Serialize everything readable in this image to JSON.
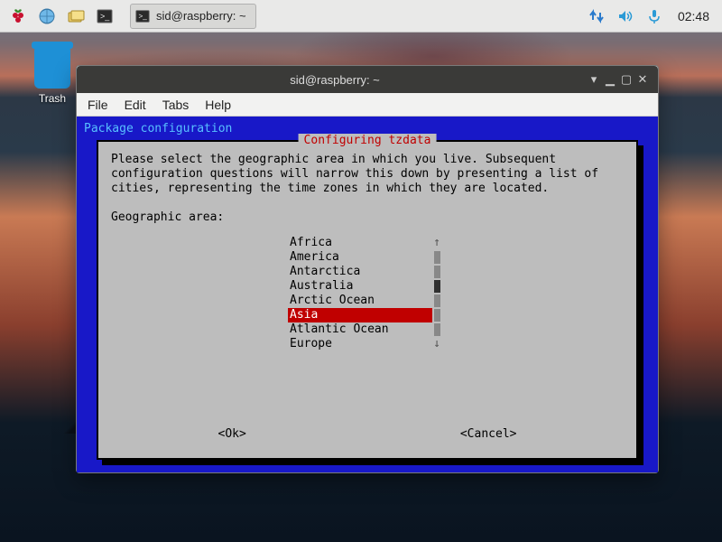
{
  "taskbar": {
    "task_label": "sid@raspberry: ~",
    "clock": "02:48"
  },
  "desktop": {
    "trash_label": "Trash"
  },
  "window": {
    "title": "sid@raspberry: ~",
    "menu": {
      "file": "File",
      "edit": "Edit",
      "tabs": "Tabs",
      "help": "Help"
    }
  },
  "tui": {
    "pkg_line": "Package configuration",
    "box_title": " Configuring tzdata ",
    "body": "Please select the geographic area in which you live. Subsequent\nconfiguration questions will narrow this down by presenting a list of\ncities, representing the time zones in which they are located.\n\nGeographic area:",
    "items": [
      {
        "label": "Africa",
        "selected": false
      },
      {
        "label": "America",
        "selected": false
      },
      {
        "label": "Antarctica",
        "selected": false
      },
      {
        "label": "Australia",
        "selected": false
      },
      {
        "label": "Arctic Ocean",
        "selected": false
      },
      {
        "label": "Asia",
        "selected": true
      },
      {
        "label": "Atlantic Ocean",
        "selected": false
      },
      {
        "label": "Europe",
        "selected": false
      }
    ],
    "scroll": {
      "up_arrow": "↑",
      "down_arrow": "↓"
    },
    "ok": "<Ok>",
    "cancel": "<Cancel>"
  }
}
